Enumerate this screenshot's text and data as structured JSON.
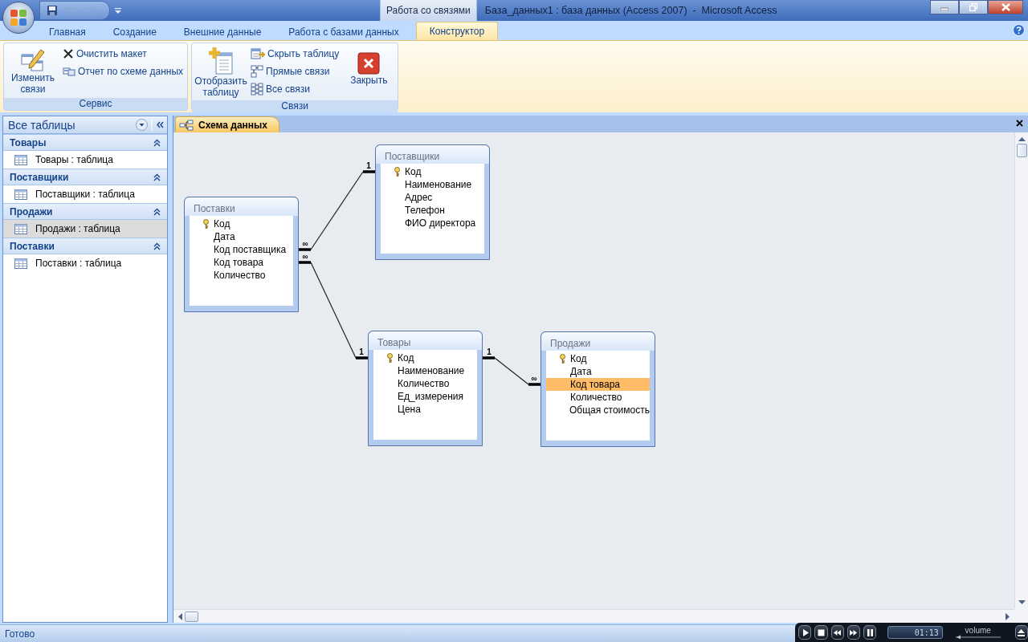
{
  "window": {
    "context_tab": "Работа со связями",
    "title": "База_данных1 : база данных (Access 2007)  -  Microsoft Access"
  },
  "ribbon_tabs": [
    {
      "label": "Главная",
      "selected": false
    },
    {
      "label": "Создание",
      "selected": false
    },
    {
      "label": "Внешние данные",
      "selected": false
    },
    {
      "label": "Работа с базами данных",
      "selected": false
    },
    {
      "label": "Конструктор",
      "selected": true
    }
  ],
  "ribbon_groups": [
    {
      "label": "Сервис",
      "commands": [
        {
          "kind": "large",
          "label": "Изменить связи"
        },
        {
          "kind": "small",
          "label": "Очистить макет"
        },
        {
          "kind": "small",
          "label": "Отчет по схеме данных"
        }
      ]
    },
    {
      "label": "Связи",
      "commands": [
        {
          "kind": "large",
          "label": "Отобразить таблицу"
        },
        {
          "kind": "small",
          "label": "Скрыть таблицу"
        },
        {
          "kind": "small",
          "label": "Прямые связи"
        },
        {
          "kind": "small",
          "label": "Все связи"
        },
        {
          "kind": "large",
          "label": "Закрыть"
        }
      ]
    }
  ],
  "navigation_pane": {
    "header": "Все таблицы",
    "groups": [
      {
        "label": "Товары",
        "expanded": true,
        "items": [
          {
            "label": "Товары : таблица",
            "selected": false
          }
        ]
      },
      {
        "label": "Поставщики",
        "expanded": true,
        "items": [
          {
            "label": "Поставщики : таблица",
            "selected": false
          }
        ]
      },
      {
        "label": "Продажи",
        "expanded": true,
        "items": [
          {
            "label": "Продажи : таблица",
            "selected": true
          }
        ]
      },
      {
        "label": "Поставки",
        "expanded": true,
        "items": [
          {
            "label": "Поставки : таблица",
            "selected": false
          }
        ]
      }
    ]
  },
  "document_tab": {
    "label": "Схема данных"
  },
  "diagram": {
    "tables": [
      {
        "title": "Поставщики",
        "fields": [
          {
            "name": "Код",
            "key": true,
            "selected": false
          },
          {
            "name": "Наименование",
            "key": false,
            "selected": false
          },
          {
            "name": "Адрес",
            "key": false,
            "selected": false
          },
          {
            "name": "Телефон",
            "key": false,
            "selected": false
          },
          {
            "name": "ФИО директора",
            "key": false,
            "selected": false
          }
        ]
      },
      {
        "title": "Поставки",
        "fields": [
          {
            "name": "Код",
            "key": true,
            "selected": false
          },
          {
            "name": "Дата",
            "key": false,
            "selected": false
          },
          {
            "name": "Код поставщика",
            "key": false,
            "selected": false
          },
          {
            "name": "Код товара",
            "key": false,
            "selected": false
          },
          {
            "name": "Количество",
            "key": false,
            "selected": false
          }
        ]
      },
      {
        "title": "Товары",
        "fields": [
          {
            "name": "Код",
            "key": true,
            "selected": false
          },
          {
            "name": "Наименование",
            "key": false,
            "selected": false
          },
          {
            "name": "Количество",
            "key": false,
            "selected": false
          },
          {
            "name": "Ед_измерения",
            "key": false,
            "selected": false
          },
          {
            "name": "Цена",
            "key": false,
            "selected": false
          }
        ]
      },
      {
        "title": "Продажи",
        "fields": [
          {
            "name": "Код",
            "key": true,
            "selected": false
          },
          {
            "name": "Дата",
            "key": false,
            "selected": false
          },
          {
            "name": "Код товара",
            "key": false,
            "selected": true
          },
          {
            "name": "Количество",
            "key": false,
            "selected": false
          },
          {
            "name": "Общая стоимость",
            "key": false,
            "selected": false
          }
        ]
      }
    ],
    "relationships": [
      {
        "start_label": "∞",
        "end_label": "1"
      },
      {
        "start_label": "∞",
        "end_label": "1"
      },
      {
        "start_label": "1",
        "end_label": "∞"
      }
    ]
  },
  "status_bar": {
    "text": "Готово"
  },
  "media_player": {
    "time": "01:13",
    "volume_label": "volume",
    "volume": {
      "level": 0.02
    }
  }
}
